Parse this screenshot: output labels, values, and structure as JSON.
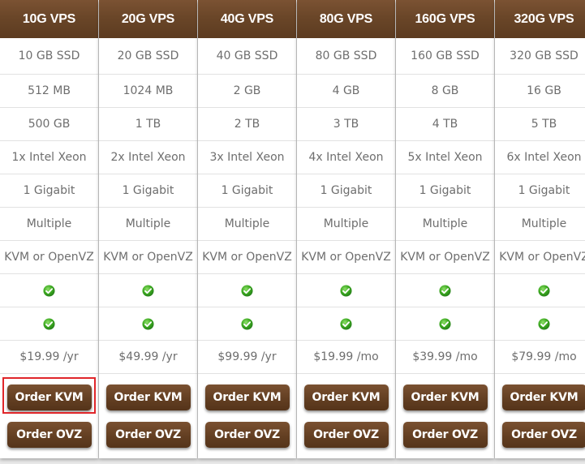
{
  "plans": [
    {
      "name": "10G VPS",
      "disk": "10 GB SSD",
      "ram": "512 MB",
      "bandwidth": "500 GB",
      "cpu": "1x Intel Xeon",
      "port": "1 Gigabit",
      "ips": "Multiple",
      "virt": "KVM or OpenVZ",
      "price": "$19.99 /yr",
      "kvm_label": "Order KVM",
      "ovz_label": "Order OVZ"
    },
    {
      "name": "20G VPS",
      "disk": "20 GB SSD",
      "ram": "1024 MB",
      "bandwidth": "1 TB",
      "cpu": "2x Intel Xeon",
      "port": "1 Gigabit",
      "ips": "Multiple",
      "virt": "KVM or OpenVZ",
      "price": "$49.99 /yr",
      "kvm_label": "Order KVM",
      "ovz_label": "Order OVZ"
    },
    {
      "name": "40G VPS",
      "disk": "40 GB SSD",
      "ram": "2 GB",
      "bandwidth": "2 TB",
      "cpu": "3x Intel Xeon",
      "port": "1 Gigabit",
      "ips": "Multiple",
      "virt": "KVM or OpenVZ",
      "price": "$99.99 /yr",
      "kvm_label": "Order KVM",
      "ovz_label": "Order OVZ"
    },
    {
      "name": "80G VPS",
      "disk": "80 GB SSD",
      "ram": "4 GB",
      "bandwidth": "3 TB",
      "cpu": "4x Intel Xeon",
      "port": "1 Gigabit",
      "ips": "Multiple",
      "virt": "KVM or OpenVZ",
      "price": "$19.99 /mo",
      "kvm_label": "Order KVM",
      "ovz_label": "Order OVZ"
    },
    {
      "name": "160G VPS",
      "disk": "160 GB SSD",
      "ram": "8 GB",
      "bandwidth": "4 TB",
      "cpu": "5x Intel Xeon",
      "port": "1 Gigabit",
      "ips": "Multiple",
      "virt": "KVM or OpenVZ",
      "price": "$39.99 /mo",
      "kvm_label": "Order KVM",
      "ovz_label": "Order OVZ"
    },
    {
      "name": "320G VPS",
      "disk": "320 GB SSD",
      "ram": "16 GB",
      "bandwidth": "5 TB",
      "cpu": "6x Intel Xeon",
      "port": "1 Gigabit",
      "ips": "Multiple",
      "virt": "KVM or OpenVZ",
      "price": "$79.99 /mo",
      "kvm_label": "Order KVM",
      "ovz_label": "Order OVZ"
    }
  ],
  "included_icon": "check-circle-icon",
  "colors": {
    "header_brown": "#6a4628",
    "button_brown": "#633f22",
    "check_green": "#3aa81e",
    "highlight_red": "#e0262a",
    "text_gray": "#6e6e6e"
  }
}
